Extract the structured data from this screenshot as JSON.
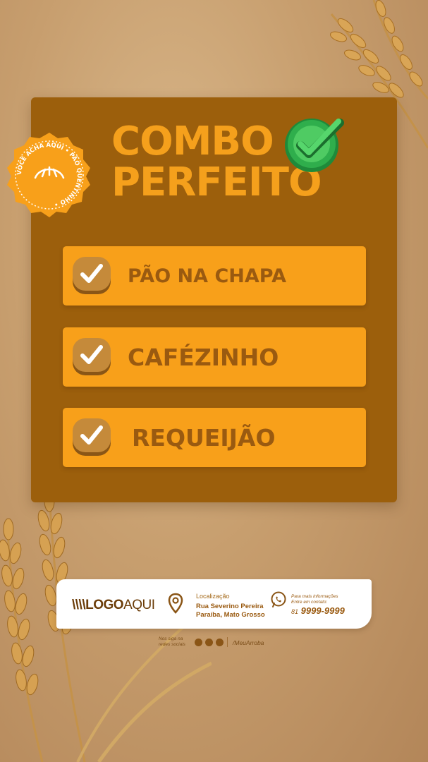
{
  "colors": {
    "panel": "#9c5f0c",
    "accent_orange": "#f8a01a",
    "title_orange": "#f5a01c",
    "text_brown": "#9a5a10",
    "background": "#c79e6e"
  },
  "header": {
    "title_line1": "COMBO",
    "title_line2": "PERFEITO",
    "badge_icon": "green-check-icon"
  },
  "seal": {
    "text": "VOCÊ ACHA AQUI • PÃO QUENTINHO •",
    "icon": "croissant-icon"
  },
  "items": [
    {
      "label": "PÃO NA CHAPA",
      "icon": "check-icon"
    },
    {
      "label": "CAFÉZINHO",
      "icon": "check-icon"
    },
    {
      "label": "REQUEIJÃO",
      "icon": "check-icon"
    }
  ],
  "footer": {
    "logo_prefix": "\\\\\\\\LOGO",
    "logo_suffix": "AQUI",
    "location_title": "Localização",
    "location_line1": "Rua Severino Pereira",
    "location_line2": "Paraíba, Mato Grosso",
    "info_line1": "Para mais informações",
    "info_line2": "Entre em contato:",
    "phone_prefix": "81",
    "phone": "9999-9999",
    "social_line1": "Nos siga na",
    "social_line2": "redes sociais",
    "handle": "/MeuArroba"
  }
}
